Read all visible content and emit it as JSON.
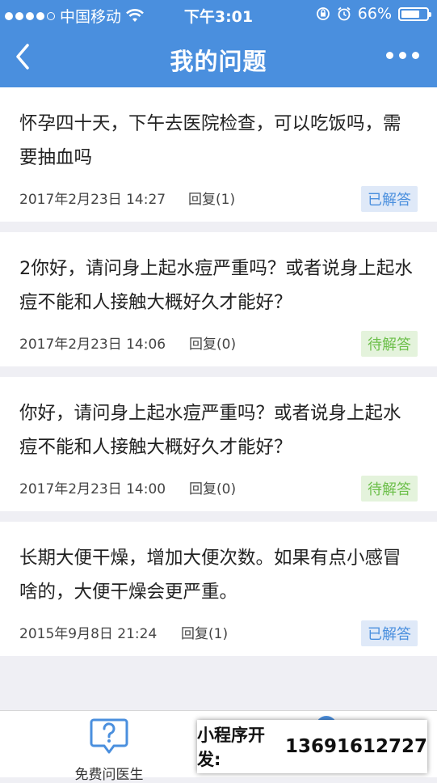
{
  "status_bar": {
    "carrier": "中国移动",
    "time": "下午3:01",
    "battery": "66%",
    "battery_level": 0.66
  },
  "nav": {
    "title": "我的问题",
    "back_icon": "chevron-left-icon",
    "more_icon": "more-dots-icon"
  },
  "questions": [
    {
      "text": "怀孕四十天，下午去医院检查，可以吃饭吗，需要抽血吗",
      "date": "2017年2月23日 14:27",
      "replies": "回复(1)",
      "status": "已解答",
      "status_type": "answered"
    },
    {
      "text": "2你好，请问身上起水痘严重吗？或者说身上起水痘不能和人接触大概好久才能好？",
      "date": "2017年2月23日 14:06",
      "replies": "回复(0)",
      "status": "待解答",
      "status_type": "pending"
    },
    {
      "text": "你好，请问身上起水痘严重吗？或者说身上起水痘不能和人接触大概好久才能好？",
      "date": "2017年2月23日 14:00",
      "replies": "回复(0)",
      "status": "待解答",
      "status_type": "pending"
    },
    {
      "text": "长期大便干燥，增加大便次数。如果有点小感冒啥的，大便干燥会更严重。",
      "date": "2015年9月8日 21:24",
      "replies": "回复(1)",
      "status": "已解答",
      "status_type": "answered"
    }
  ],
  "tab_bar": {
    "ask_doctor_label": "免费问医生",
    "ask_doctor_icon": "question-bubble-icon"
  },
  "promo": {
    "label": "小程序开发:",
    "phone": "13691612727"
  },
  "colors": {
    "primary": "#4a8fde",
    "answered_bg": "#dfe9f8",
    "pending_bg": "#e4f3dc",
    "pending_text": "#6cbf4a",
    "background": "#efeff4"
  }
}
